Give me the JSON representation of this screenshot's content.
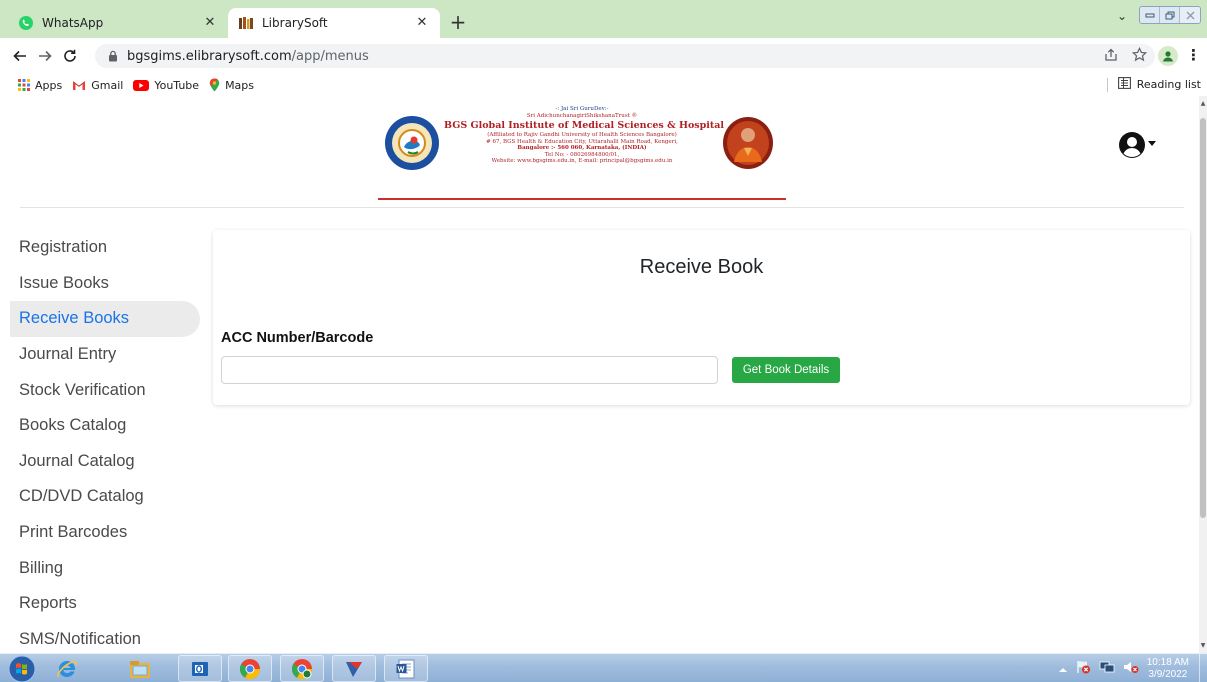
{
  "browser": {
    "tabs": [
      {
        "title": "WhatsApp",
        "active": false
      },
      {
        "title": "LibrarySoft",
        "active": true
      }
    ],
    "url_host": "bgsgims.elibrarysoft.com",
    "url_path": "/app/menus",
    "bookmarks": [
      {
        "label": "Apps",
        "icon": "apps-grid-icon"
      },
      {
        "label": "Gmail",
        "icon": "gmail-icon"
      },
      {
        "label": "YouTube",
        "icon": "youtube-icon"
      },
      {
        "label": "Maps",
        "icon": "maps-icon"
      }
    ],
    "reading_list": "Reading list"
  },
  "header": {
    "line1": "-: Jai Sri GuruDev:-",
    "line2": "Sri AdichunchanagiriShikshanaTrust ®",
    "line3": "BGS Global Institute of Medical Sciences & Hospital",
    "line4": "(Affiliated to Rajiv Gandhi University of Health Sciences Bangalore)",
    "line5": "# 67, BGS Health & Education City, Uttarahalli Main Road, Kengeri,",
    "line6": "Bangalore :- 560 060, Karnataka, (INDIA)",
    "line7": "Tel No: - 08026984800/01,",
    "line8": "Website: www.bgsgims.edu.in, E-mail: principal@bgsgims.edu.in"
  },
  "sidebar": {
    "items": [
      {
        "label": "Registration",
        "active": false
      },
      {
        "label": "Issue Books",
        "active": false
      },
      {
        "label": "Receive Books",
        "active": true
      },
      {
        "label": "Journal Entry",
        "active": false
      },
      {
        "label": "Stock Verification",
        "active": false
      },
      {
        "label": "Books Catalog",
        "active": false
      },
      {
        "label": "Journal Catalog",
        "active": false
      },
      {
        "label": "CD/DVD Catalog",
        "active": false
      },
      {
        "label": "Print Barcodes",
        "active": false
      },
      {
        "label": "Billing",
        "active": false
      },
      {
        "label": "Reports",
        "active": false
      },
      {
        "label": "SMS/Notification",
        "active": false
      }
    ]
  },
  "main": {
    "title": "Receive Book",
    "field_label": "ACC Number/Barcode",
    "input_value": "",
    "button_label": "Get Book Details"
  },
  "taskbar": {
    "time": "10:18 AM",
    "date": "3/9/2022"
  },
  "colors": {
    "tabbar": "#cde6c4",
    "active_nav": "#1a73e8",
    "button_green": "#28a745",
    "header_red": "#c9302c"
  }
}
